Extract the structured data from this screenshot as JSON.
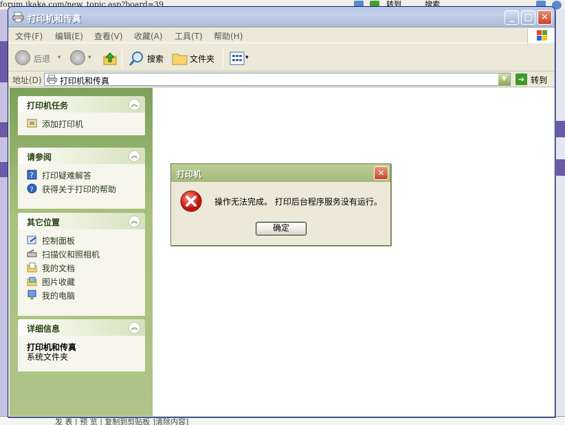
{
  "background": {
    "url_fragment": "forum.ikaka.com/new_topic.asp?board=39",
    "go_label": "转到",
    "search_label": "搜索",
    "bottom_text": "发 表 | 预 览 | 复制到剪贴板 ]清除内容]"
  },
  "window": {
    "title": "打印机和传真",
    "menu": [
      "文件(F)",
      "编辑(E)",
      "查看(V)",
      "收藏(A)",
      "工具(T)",
      "帮助(H)"
    ],
    "toolbar": {
      "back": "后退",
      "search": "搜索",
      "folders": "文件夹"
    },
    "address": {
      "label": "地址(D)",
      "value": "打印机和传真",
      "go": "转到"
    }
  },
  "taskpane": {
    "printer_tasks": {
      "title": "打印机任务",
      "items": [
        "添加打印机"
      ]
    },
    "see_also": {
      "title": "请参阅",
      "items": [
        "打印疑难解答",
        "获得关于打印的帮助"
      ]
    },
    "other_places": {
      "title": "其它位置",
      "items": [
        "控制面板",
        "扫描仪和照相机",
        "我的文档",
        "图片收藏",
        "我的电脑"
      ]
    },
    "details": {
      "title": "详细信息",
      "name": "打印机和传真",
      "type": "系统文件夹"
    }
  },
  "dialog": {
    "title": "打印机",
    "message": "操作无法完成。 打印后台程序服务没有运行。",
    "ok": "确定"
  },
  "colors": {
    "taskpane_green": "#a9c27e",
    "dialog_titlebar": "#a4b97a",
    "close_red": "#c6462a",
    "error_red": "#d8241c"
  }
}
